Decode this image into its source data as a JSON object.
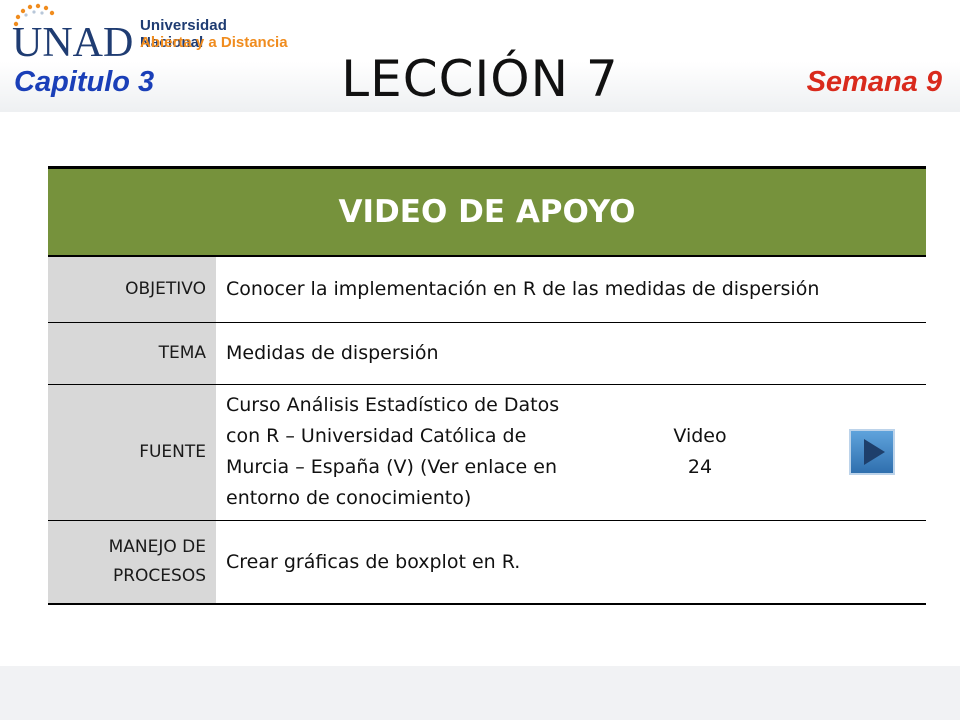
{
  "logo": {
    "mark": "UNAD",
    "line1": "Universidad Nacional",
    "line2": "Abierta y a Distancia"
  },
  "header": {
    "capitulo": "Capitulo 3",
    "leccion": "LECCIÓN 7",
    "semana": "Semana 9"
  },
  "table": {
    "title": "VIDEO DE APOYO",
    "objetivo_label": "OBJETIVO",
    "objetivo_value": "Conocer la implementación en R de las medidas de dispersión",
    "tema_label": "TEMA",
    "tema_value": "Medidas de dispersión",
    "fuente_label": "FUENTE",
    "fuente_lines": [
      "Curso Análisis Estadístico de Datos",
      "con R – Universidad Católica de",
      "Murcia – España (V) (Ver enlace en",
      "entorno de conocimiento)"
    ],
    "video_label": "Video",
    "video_number": "24",
    "manejo_label_1": "MANEJO DE",
    "manejo_label_2": "PROCESOS",
    "manejo_value": "Crear gráficas de boxplot en R."
  },
  "icons": {
    "play": "play-button-icon"
  },
  "colors": {
    "table_header_bg": "#76923c",
    "label_bg": "#d8d8d8",
    "capitulo": "#1a3fb8",
    "semana": "#d92a1c",
    "logo_blue": "#1f3c72",
    "logo_orange": "#f08c1e",
    "play_button": "#3f86c6"
  }
}
